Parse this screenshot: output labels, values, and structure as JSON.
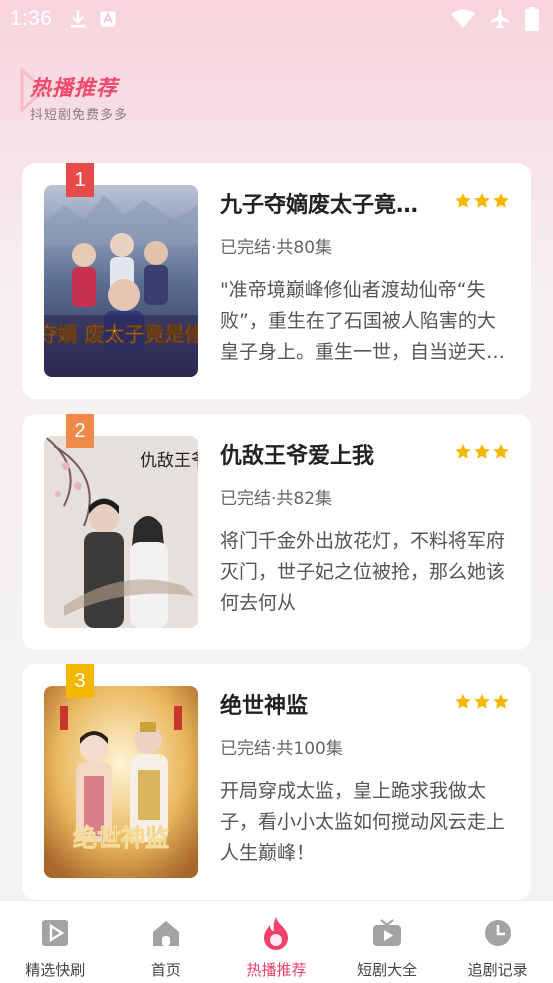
{
  "status_bar": {
    "time": "1:36"
  },
  "header": {
    "title": "热播推荐",
    "subtitle": "抖短剧免费多多"
  },
  "colors": {
    "accent": "#f2426b",
    "star": "#f5b800",
    "rank1": "#e84a4a",
    "rank2": "#f08a4b",
    "rank3": "#f5b800"
  },
  "dramas": [
    {
      "rank": "1",
      "title": "九子夺嫡废太子竟是修仙者",
      "meta": "已完结·共80集",
      "description": "\"准帝境巅峰修仙者渡劫仙帝“失败”，重生在了石国被人陷害的大皇子身上。重生一世，自当逆天改命",
      "cover_text": "九子夺嫡 废太子竟是修仙者"
    },
    {
      "rank": "2",
      "title": "仇敌王爷爱上我",
      "meta": "已完结·共82集",
      "description": "将门千金外出放花灯，不料将军府灭门，世子妃之位被抢，那么她该何去何从",
      "cover_text": "仇敌王爷爱上我"
    },
    {
      "rank": "3",
      "title": "绝世神监",
      "meta": "已完结·共100集",
      "description": "开局穿成太监，皇上跪求我做太子，看小小太监如何搅动风云走上人生巅峰！",
      "cover_text": "绝世神监"
    }
  ],
  "bottom_nav": [
    {
      "label": "精选快刷",
      "icon": "play-square-icon"
    },
    {
      "label": "首页",
      "icon": "home-icon"
    },
    {
      "label": "热播推荐",
      "icon": "flame-icon",
      "active": true
    },
    {
      "label": "短剧大全",
      "icon": "tv-icon"
    },
    {
      "label": "追剧记录",
      "icon": "clock-icon"
    }
  ]
}
